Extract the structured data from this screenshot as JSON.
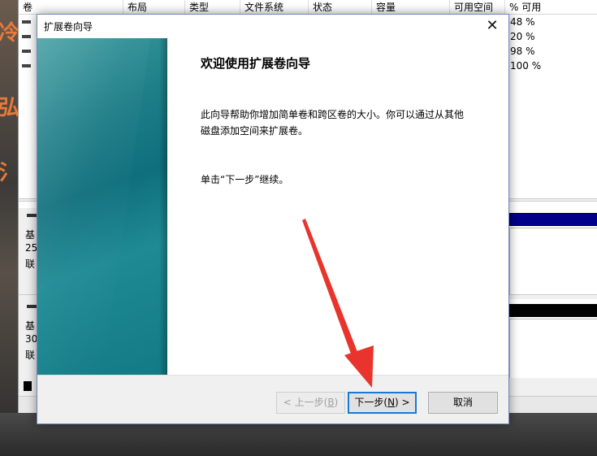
{
  "disk_manager": {
    "columns": [
      "卷",
      "布局",
      "类型",
      "文件系统",
      "状态",
      "容量",
      "可用空间",
      "% 可用"
    ],
    "volume_rows": [
      {
        "pct_free": "48 %"
      },
      {
        "pct_free": "20 %"
      },
      {
        "pct_free": "98 %"
      },
      {
        "pct_free": "100 %"
      }
    ],
    "disk0": {
      "line1": "基",
      "line2": "25",
      "line3": "联"
    },
    "disk1": {
      "line1": "基",
      "line2": "30",
      "line3": "联"
    }
  },
  "wizard": {
    "title": "扩展卷向导",
    "close_glyph": "✕",
    "heading": "欢迎使用扩展卷向导",
    "desc_line1": "此向导帮助你增加简单卷和跨区卷的大小。你可以通过从其他",
    "desc_line2": "磁盘添加空间来扩展卷。",
    "next_hint": "单击“下一步”继续。",
    "buttons": {
      "back_prefix": "< 上一步(",
      "back_key": "B",
      "back_suffix": ")",
      "next_prefix": "下一步(",
      "next_key": "N",
      "next_suffix": ") >",
      "cancel": "取消"
    }
  },
  "colors": {
    "accent": "#1a78d3",
    "arrow": "#e8342c",
    "side_panel": "#1e7e88"
  }
}
